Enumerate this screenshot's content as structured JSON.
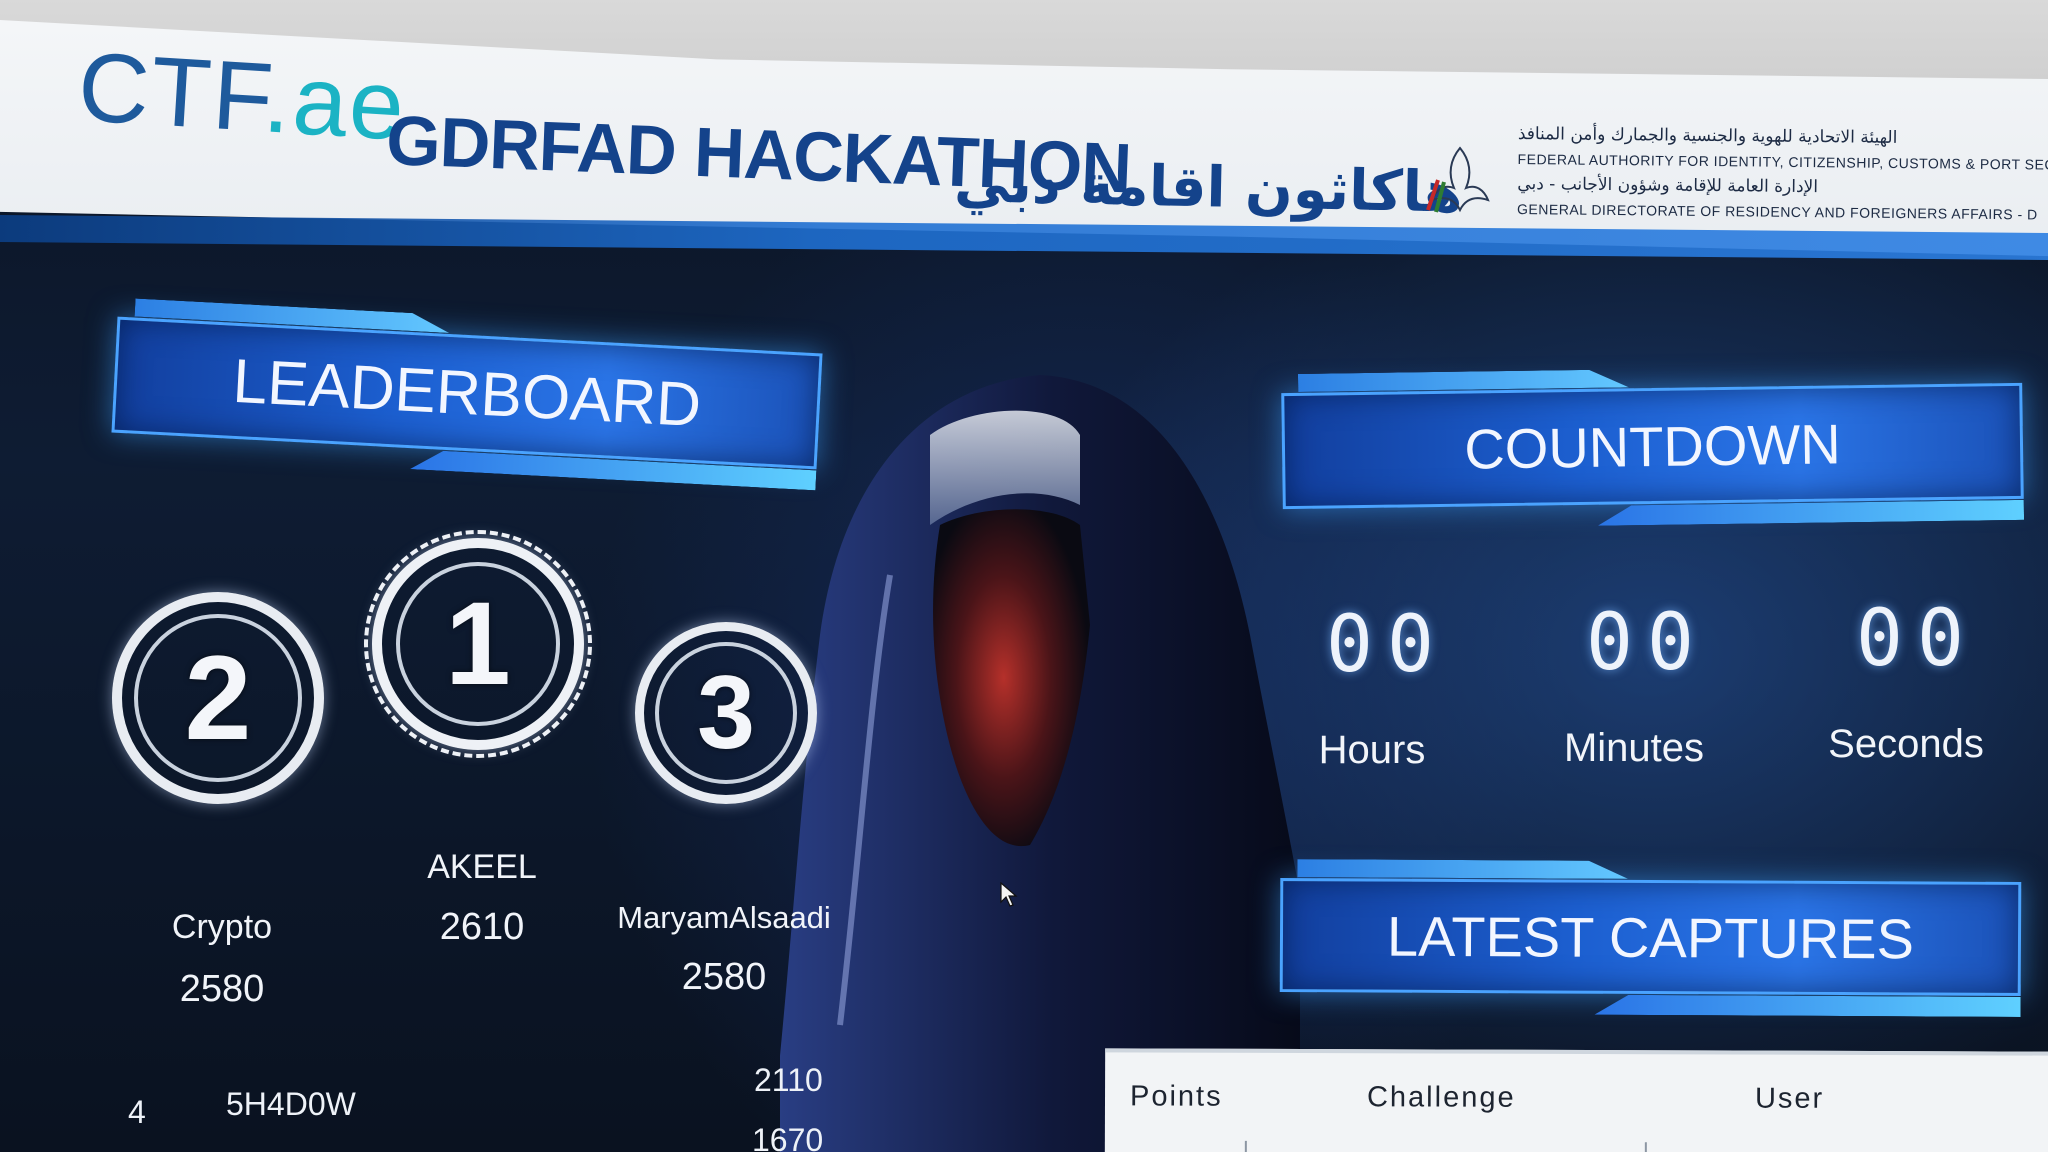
{
  "header": {
    "logo_main": "CTF",
    "logo_accent": ".ae",
    "title_en": "GDRFAD HACKATHON",
    "title_ar": "هاكاثون اقامة دبي",
    "authority_ar_1": "الهيئة الاتحادية للهوية والجنسية والجمارك وأمن المنافذ",
    "authority_en_1": "FEDERAL AUTHORITY FOR IDENTITY, CITIZENSHIP, CUSTOMS & PORT SECU",
    "authority_ar_2": "الإدارة العامة للإقامة وشؤون الأجانب - دبي",
    "authority_en_2": "GENERAL DIRECTORATE OF RESIDENCY AND FOREIGNERS AFFAIRS - D"
  },
  "leaderboard": {
    "title": "LEADERBOARD",
    "podium": [
      {
        "rank": "2",
        "name": "Crypto",
        "score": "2580"
      },
      {
        "rank": "1",
        "name": "AKEEL",
        "score": "2610"
      },
      {
        "rank": "3",
        "name": "MaryamAlsaadi",
        "score": "2580"
      }
    ],
    "rows": [
      {
        "rank": "4",
        "name": "5H4D0W",
        "score": "2110"
      },
      {
        "rank": "",
        "name": "",
        "score": "1670"
      }
    ]
  },
  "countdown": {
    "title": "COUNTDOWN",
    "hours": "00",
    "minutes": "00",
    "seconds": "00",
    "hours_label": "Hours",
    "minutes_label": "Minutes",
    "seconds_label": "Seconds"
  },
  "captures": {
    "title": "LATEST CAPTURES",
    "columns": [
      "Points",
      "Challenge",
      "User"
    ]
  },
  "icons": {
    "falcon": "falcon-emblem-icon",
    "cursor": "mouse-pointer-icon"
  },
  "colors": {
    "brand_blue": "#14438b",
    "accent_teal": "#1bb3c4",
    "banner_blue": "#1c5fd0",
    "glow": "#4aa3ff"
  }
}
